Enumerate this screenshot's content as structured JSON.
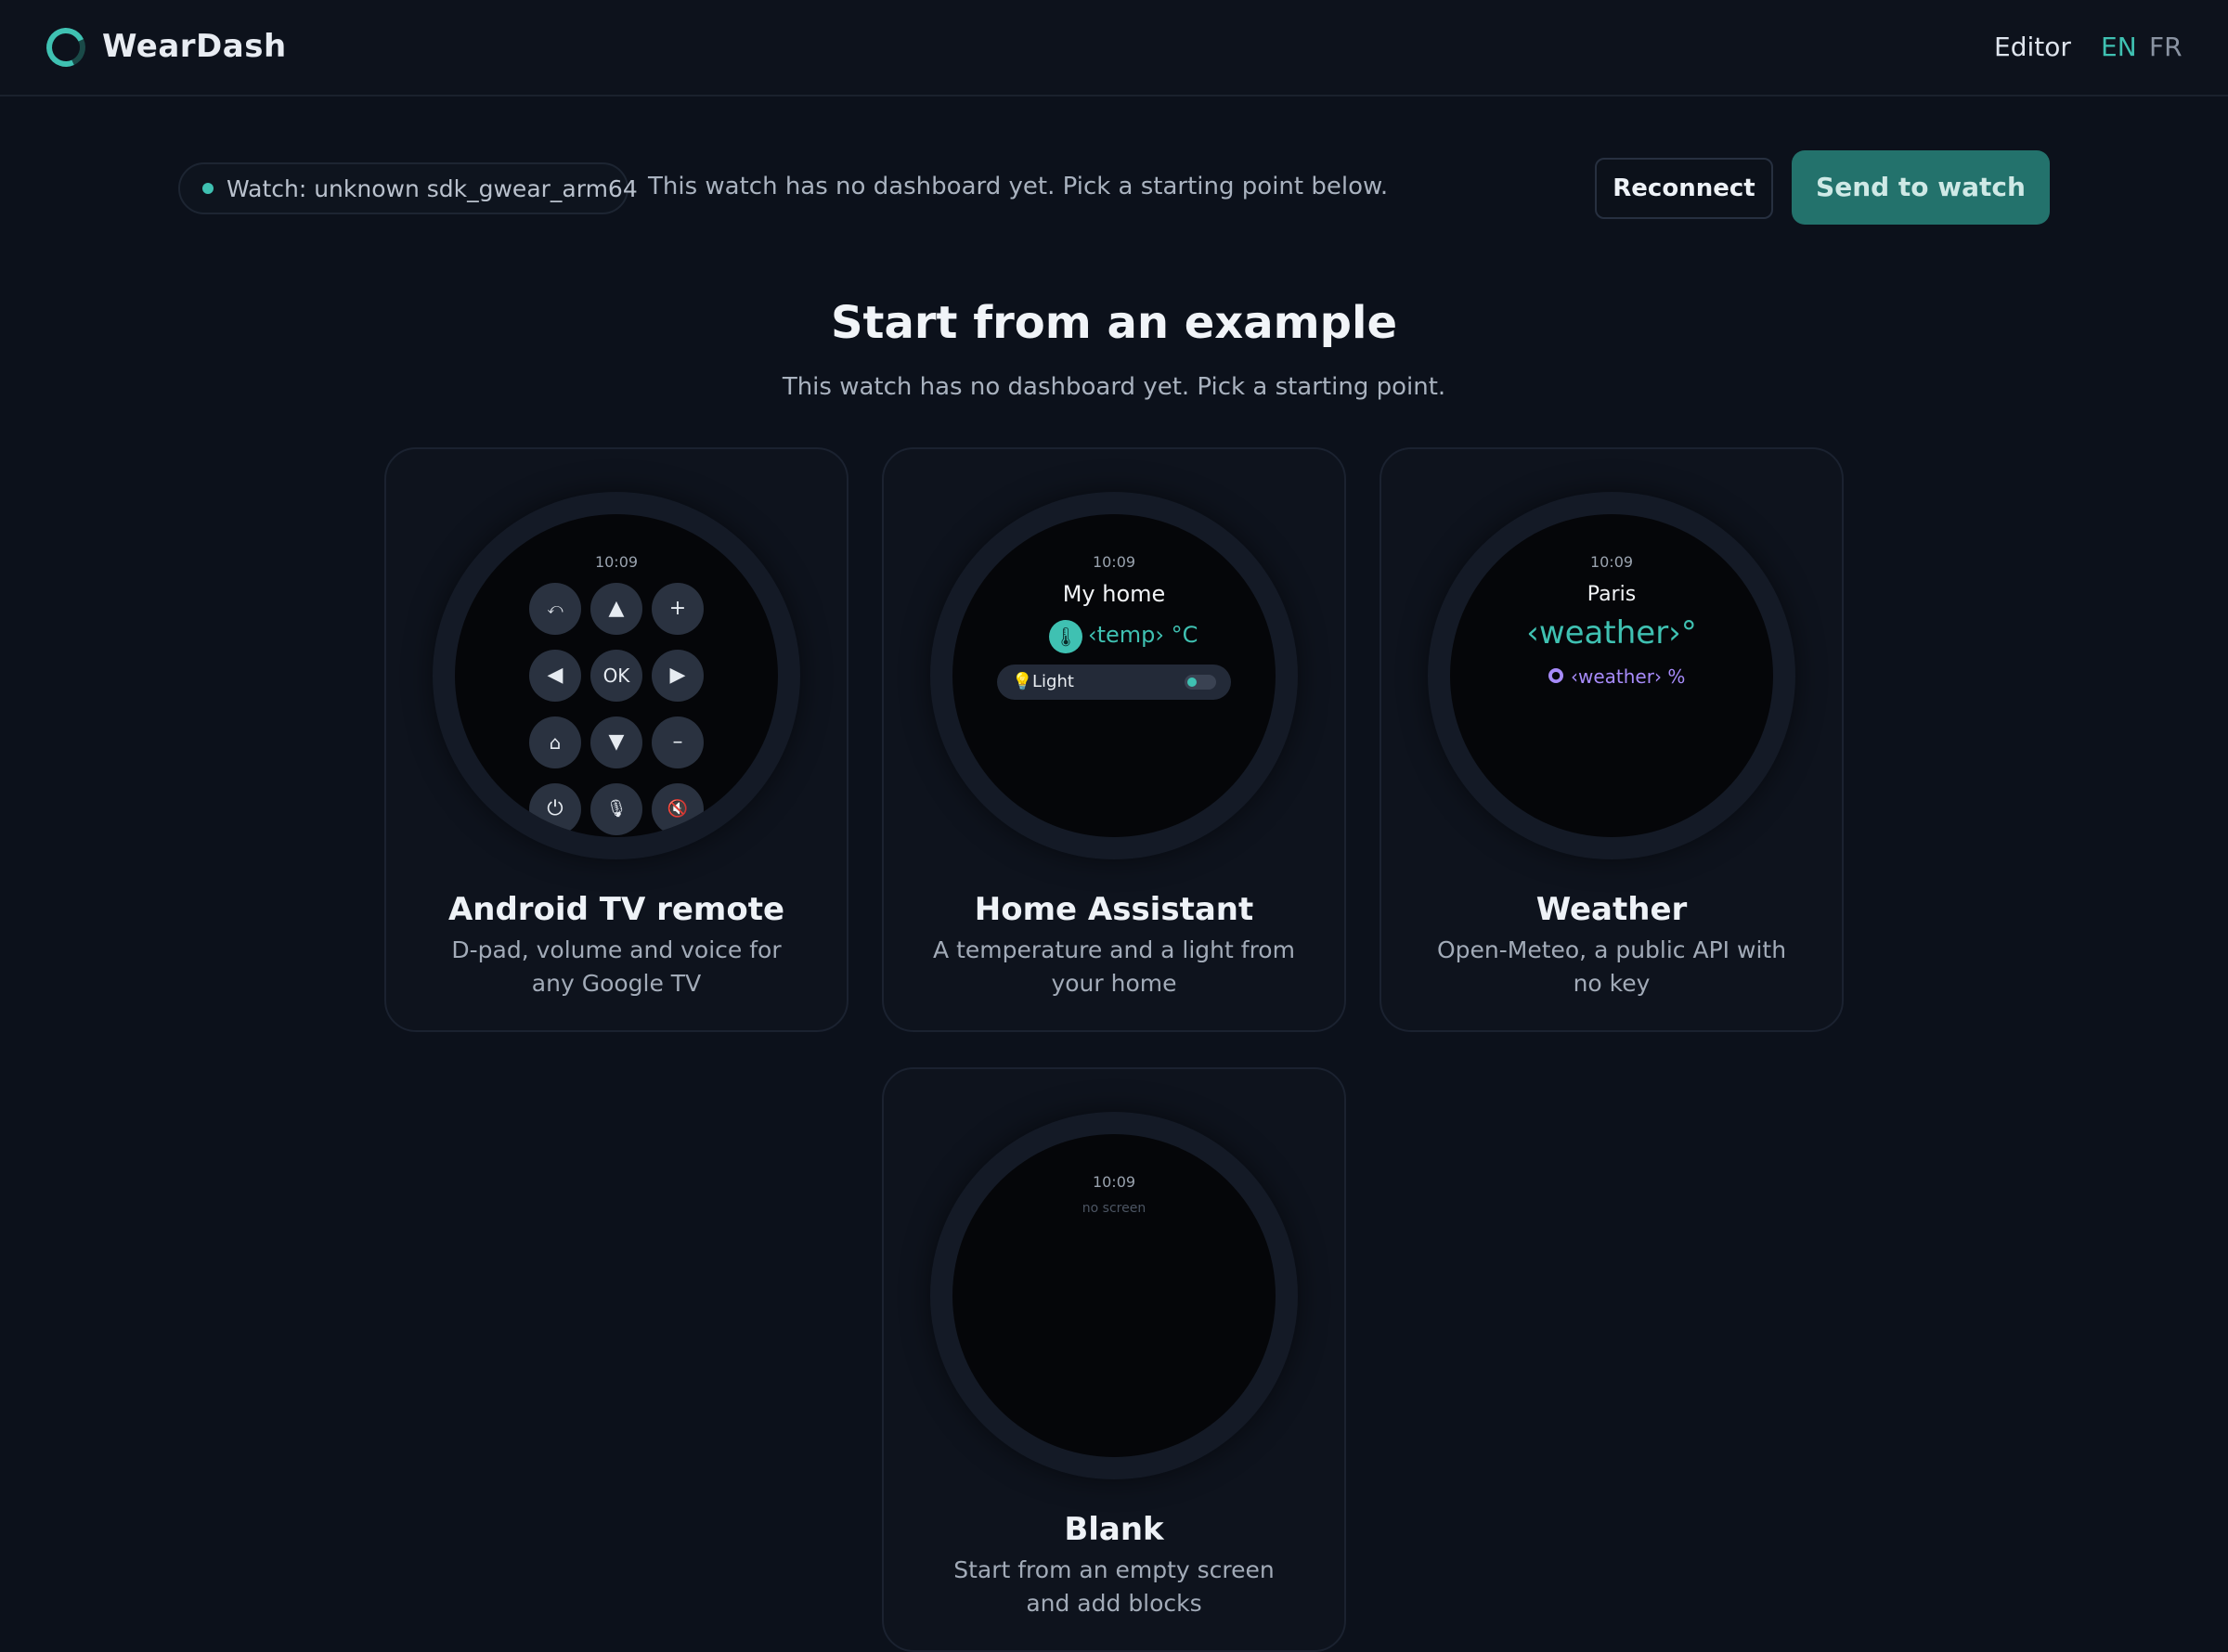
{
  "app": {
    "brand": "WearDash"
  },
  "nav": {
    "editor": "Editor",
    "lang_en": "EN",
    "lang_fr": "FR"
  },
  "status": {
    "watch_label": "Watch: unknown sdk_gwear_arm64",
    "message": "This watch has no dashboard yet. Pick a starting point below."
  },
  "actions": {
    "reconnect": "Reconnect",
    "send": "Send to watch"
  },
  "section": {
    "title": "Start from an example",
    "subtitle": "This watch has no dashboard yet. Pick a starting point."
  },
  "colors": {
    "accent": "#3fc1b2",
    "humidity": "#a78bfa",
    "background": "#0c111b"
  },
  "cards": [
    {
      "title": "Android TV remote",
      "desc": "D-pad, volume and voice for any Google TV",
      "preview": {
        "time": "10:09",
        "buttons": {
          "back": "⤺",
          "up": "▲",
          "vol_up": "+",
          "left": "◀",
          "ok": "OK",
          "right": "▶",
          "home": "⌂",
          "down": "▼",
          "vol_down": "–",
          "power": "⏻",
          "mic": "🎙",
          "mute": "🔇"
        }
      }
    },
    {
      "title": "Home Assistant",
      "desc": "A temperature and a light from your home",
      "preview": {
        "time": "10:09",
        "home": "My home",
        "temp": "‹temp› °C",
        "light": "Light",
        "light_on": true
      }
    },
    {
      "title": "Weather",
      "desc": "Open-Meteo, a public API with no key",
      "preview": {
        "time": "10:09",
        "city": "Paris",
        "temp": "‹weather›°",
        "humidity": "‹weather› %"
      }
    },
    {
      "title": "Blank",
      "desc": "Start from an empty screen and add blocks",
      "preview": {
        "time": "10:09",
        "note": "no screen"
      }
    }
  ]
}
